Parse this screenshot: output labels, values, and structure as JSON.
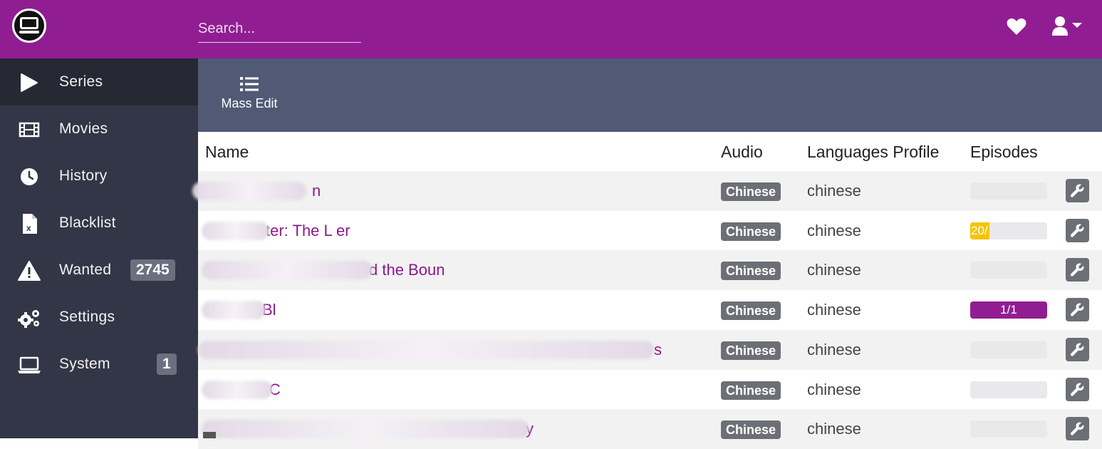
{
  "header": {
    "search_placeholder": "Search...",
    "logo_icon": "tv-icon",
    "favorite_icon": "heart-icon",
    "user_icon": "user-dropdown-icon",
    "brand_color": "#911d93"
  },
  "sidebar": {
    "items": [
      {
        "label": "Series",
        "icon": "play-icon",
        "active": true
      },
      {
        "label": "Movies",
        "icon": "film-icon"
      },
      {
        "label": "History",
        "icon": "clock-icon"
      },
      {
        "label": "Blacklist",
        "icon": "file-excel-icon"
      },
      {
        "label": "Wanted",
        "icon": "warning-icon",
        "badge": "2745"
      },
      {
        "label": "Settings",
        "icon": "cogs-icon"
      },
      {
        "label": "System",
        "icon": "laptop-icon",
        "badge": "1"
      }
    ]
  },
  "toolbar": {
    "mass_edit_label": "Mass Edit",
    "mass_edit_icon": "list-icon"
  },
  "table": {
    "headers": {
      "name": "Name",
      "audio": "Audio",
      "profile": "Languages Profile",
      "episodes": "Episodes"
    },
    "rows": [
      {
        "name_visible": "n",
        "audio": "Chinese",
        "profile": "chinese",
        "episodes": "",
        "episodes_progress": 0
      },
      {
        "name_visible": "ter: The L    er",
        "audio": "Chinese",
        "profile": "chinese",
        "episodes": "20/",
        "episodes_progress": 0.25,
        "episodes_color": "#f5c400"
      },
      {
        "name_visible": "d the Boun",
        "audio": "Chinese",
        "profile": "chinese",
        "episodes": "",
        "episodes_progress": 0
      },
      {
        "name_visible": "Bl",
        "audio": "Chinese",
        "profile": "chinese",
        "episodes": "1/1",
        "episodes_progress": 1.0,
        "episodes_color": "#911d93"
      },
      {
        "name_visible": "s",
        "audio": "Chinese",
        "profile": "chinese",
        "episodes": "",
        "episodes_progress": 0
      },
      {
        "name_visible": "C",
        "audio": "Chinese",
        "profile": "chinese",
        "episodes": "",
        "episodes_progress": 0
      },
      {
        "name_visible": "y",
        "audio": "Chinese",
        "profile": "chinese",
        "episodes": "",
        "episodes_progress": 0
      }
    ],
    "action_icon": "wrench-icon"
  }
}
